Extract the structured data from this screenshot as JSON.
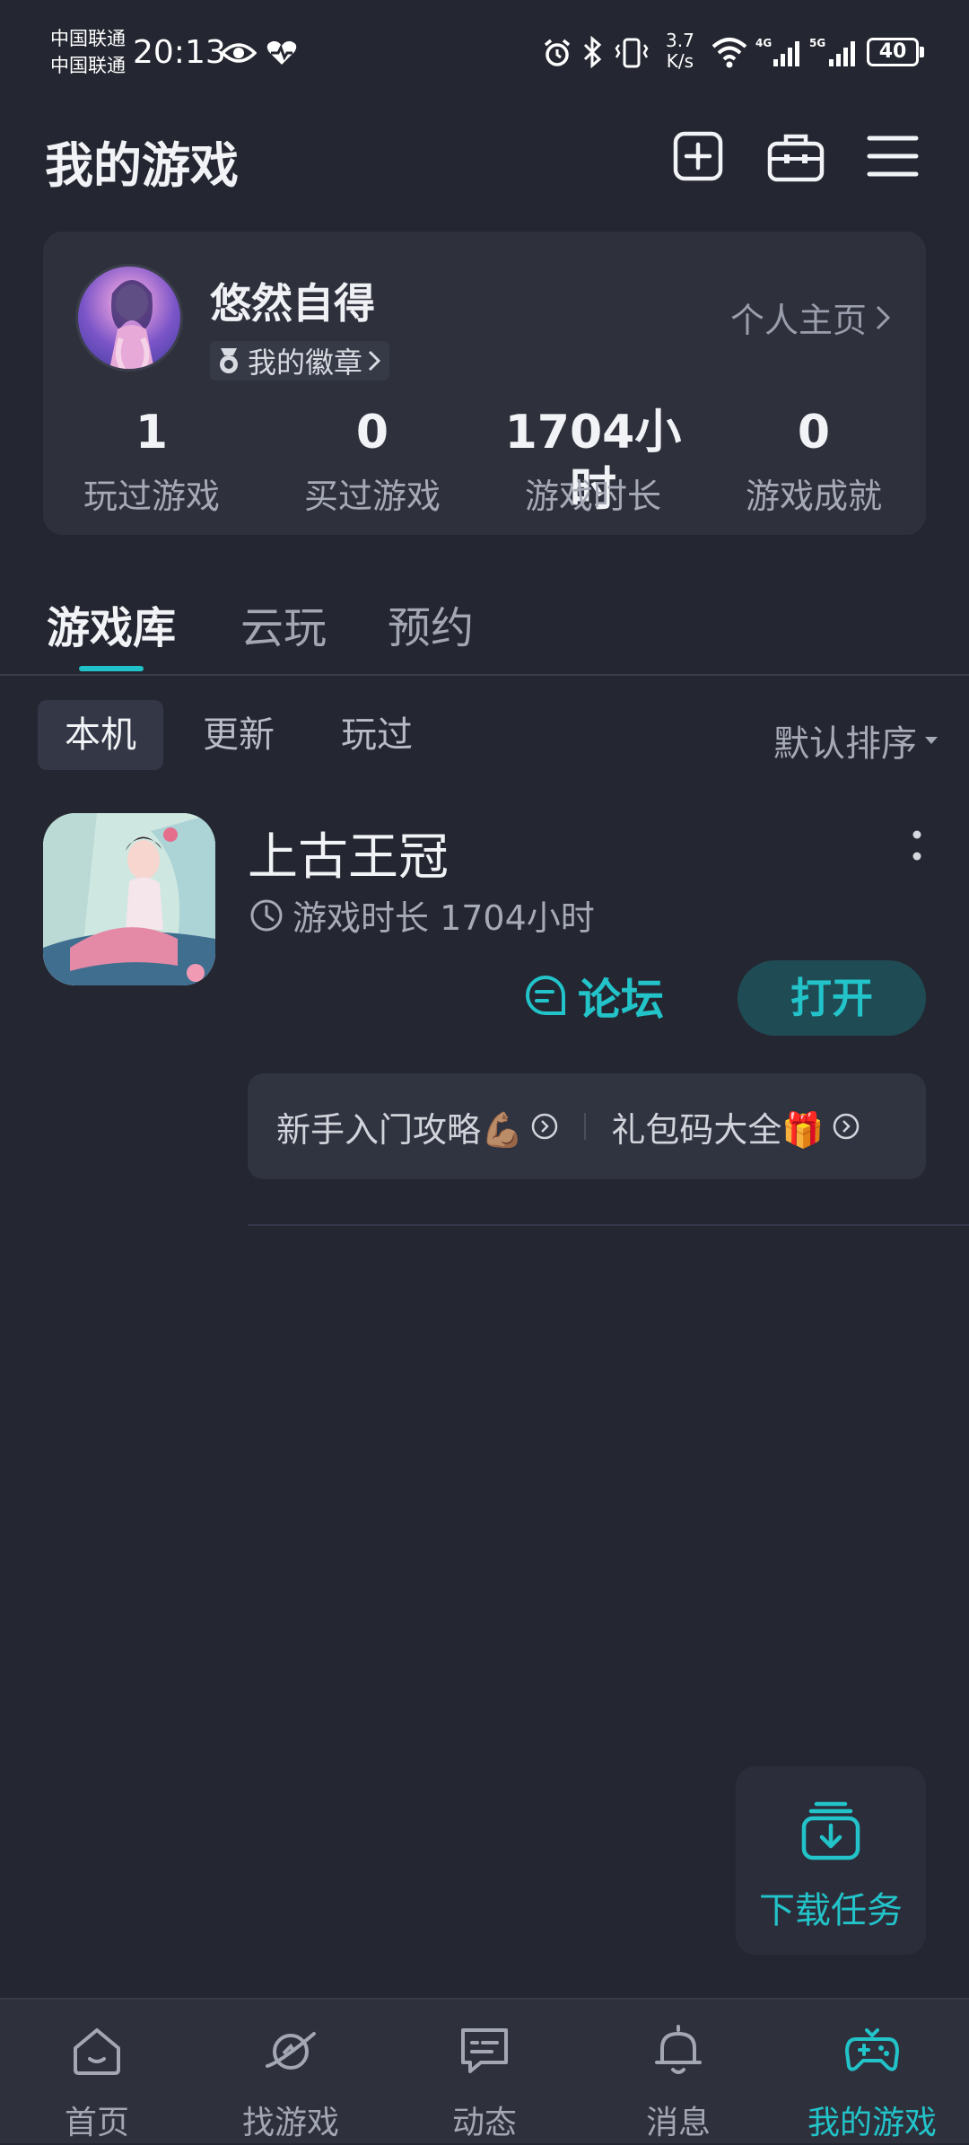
{
  "status_bar": {
    "carrier1": "中国联通",
    "carrier2": "中国联通",
    "time": "20:13",
    "speed_value": "3.7",
    "speed_unit": "K/s",
    "battery": "40"
  },
  "header": {
    "title": "我的游戏",
    "icons": [
      "add-icon",
      "toolbox-icon",
      "menu-icon"
    ]
  },
  "profile": {
    "username": "悠然自得",
    "badge_label": "我的徽章",
    "profile_link": "个人主页",
    "stats": [
      {
        "value": "1",
        "label": "玩过游戏"
      },
      {
        "value": "0",
        "label": "买过游戏"
      },
      {
        "value": "1704小时",
        "label": "游戏时长"
      },
      {
        "value": "0",
        "label": "游戏成就"
      }
    ]
  },
  "tabs": [
    {
      "label": "游戏库",
      "active": true
    },
    {
      "label": "云玩",
      "active": false
    },
    {
      "label": "预约",
      "active": false
    }
  ],
  "filters": [
    {
      "label": "本机",
      "active": true
    },
    {
      "label": "更新",
      "active": false
    },
    {
      "label": "玩过",
      "active": false
    }
  ],
  "sort_label": "默认排序",
  "game": {
    "name": "上古王冠",
    "play_time": "游戏时长 1704小时",
    "forum_label": "论坛",
    "open_label": "打开",
    "guides": [
      {
        "label": "新手入门攻略💪🏽"
      },
      {
        "label": "礼包码大全🎁"
      }
    ]
  },
  "download_label": "下载任务",
  "nav": [
    {
      "label": "首页",
      "icon": "home-icon",
      "active": false
    },
    {
      "label": "找游戏",
      "icon": "planet-icon",
      "active": false
    },
    {
      "label": "动态",
      "icon": "chat-icon",
      "active": false
    },
    {
      "label": "消息",
      "icon": "bell-icon",
      "active": false
    },
    {
      "label": "我的游戏",
      "icon": "gamepad-icon",
      "active": true
    }
  ],
  "colors": {
    "background": "#242731",
    "card": "#2e313c",
    "accent": "#22c3c9",
    "open_button_bg": "#1f4b54"
  }
}
